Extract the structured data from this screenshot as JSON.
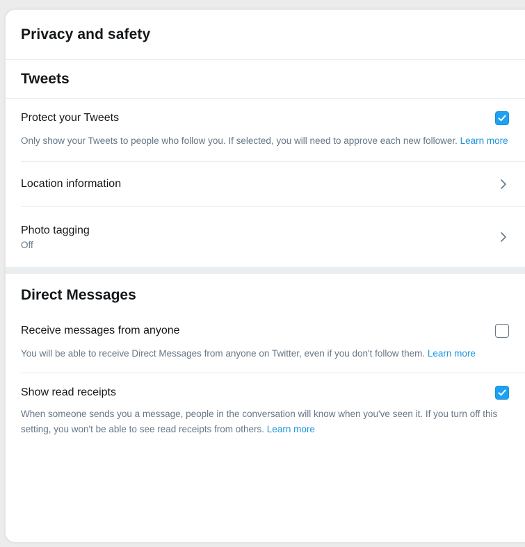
{
  "page": {
    "title": "Privacy and safety"
  },
  "tweets_section": {
    "title": "Tweets",
    "protect": {
      "label": "Protect your Tweets",
      "checked": true,
      "description": "Only show your Tweets to people who follow you. If selected, you will need to approve each new follower.",
      "link": "Learn more"
    },
    "location": {
      "label": "Location information"
    },
    "photo_tagging": {
      "label": "Photo tagging",
      "value": "Off"
    }
  },
  "dm_section": {
    "title": "Direct Messages",
    "receive": {
      "label": "Receive messages from anyone",
      "checked": false,
      "description": "You will be able to receive Direct Messages from anyone on Twitter, even if you don't follow them.",
      "link": "Learn more"
    },
    "read_receipts": {
      "label": "Show read receipts",
      "checked": true,
      "description": "When someone sends you a message, people in the conversation will know when you've seen it. If you turn off this setting, you won't be able to see read receipts from others.",
      "link": "Learn more"
    }
  },
  "colors": {
    "accent": "#1da1f2",
    "link": "#1b95e0",
    "secondary_text": "#657786"
  },
  "icons": {
    "check": "check-icon",
    "chevron": "chevron-right-icon"
  }
}
